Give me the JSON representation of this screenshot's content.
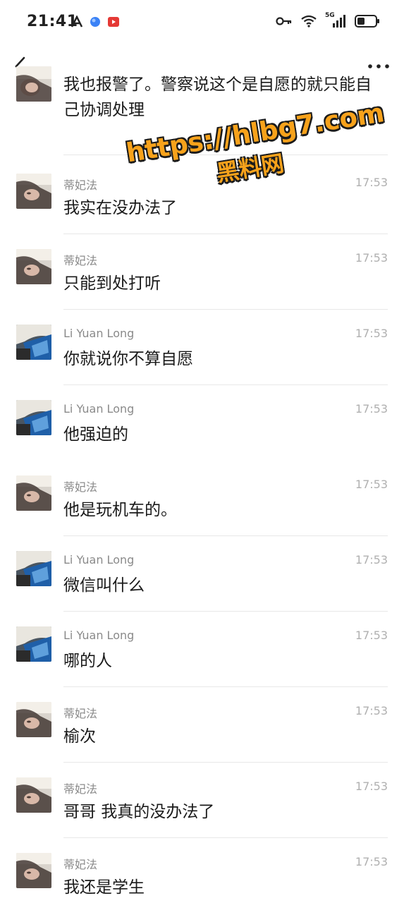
{
  "status": {
    "time": "21:41",
    "network": "5G"
  },
  "avatars": {
    "a": "woman-avatar",
    "b": "li-avatar"
  },
  "messages": [
    {
      "text": "我也报警了。警察说这个是自愿的就只能自己协调处理",
      "avatar": "woman-avatar"
    },
    {
      "sender": "蒂妃法",
      "time": "17:53",
      "text": "我实在没办法了",
      "avatar": "woman-avatar"
    },
    {
      "sender": "蒂妃法",
      "time": "17:53",
      "text": "只能到处打听",
      "avatar": "woman-avatar"
    },
    {
      "sender": "Li Yuan Long",
      "time": "17:53",
      "text": "你就说你不算自愿",
      "avatar": "li-avatar"
    },
    {
      "sender": "Li Yuan Long",
      "time": "17:53",
      "text": "他强迫的",
      "avatar": "li-avatar"
    },
    {
      "sender": "蒂妃法",
      "time": "17:53",
      "text": "他是玩机车的。",
      "avatar": "woman-avatar"
    },
    {
      "sender": "Li Yuan Long",
      "time": "17:53",
      "text": "微信叫什么",
      "avatar": "li-avatar"
    },
    {
      "sender": "Li Yuan Long",
      "time": "17:53",
      "text": "哪的人",
      "avatar": "li-avatar"
    },
    {
      "sender": "蒂妃法",
      "time": "17:53",
      "text": "榆次",
      "avatar": "woman-avatar"
    },
    {
      "sender": "蒂妃法",
      "time": "17:53",
      "text": "哥哥 我真的没办法了",
      "avatar": "woman-avatar"
    },
    {
      "sender": "蒂妃法",
      "time": "17:53",
      "text": "我还是学生",
      "avatar": "woman-avatar"
    }
  ],
  "watermark": {
    "url": "https://hlbg7.com",
    "name": "黑料网"
  }
}
